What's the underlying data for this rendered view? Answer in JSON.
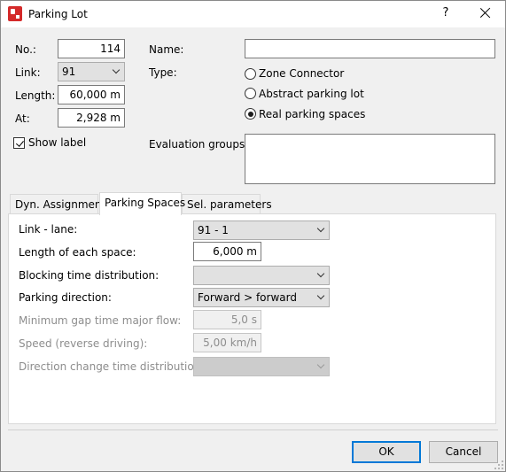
{
  "window": {
    "title": "Parking Lot",
    "help_label": "?",
    "close_icon": "close-icon",
    "app_icon": "parking-lot-app-icon",
    "accent": "#0078d7"
  },
  "general": {
    "no_label": "No.:",
    "no_value": "114",
    "link_label": "Link:",
    "link_value": "91",
    "length_label": "Length:",
    "length_value": "60,000 m",
    "at_label": "At:",
    "at_value": "2,928 m",
    "show_label_text": "Show label",
    "show_label_checked": true,
    "name_label": "Name:",
    "name_value": "",
    "type_label": "Type:",
    "type_options": [
      "Zone Connector",
      "Abstract parking lot",
      "Real parking spaces"
    ],
    "type_selected": "Real parking spaces",
    "eval_groups_label": "Evaluation groups:",
    "eval_groups_value": ""
  },
  "tabs": [
    "Dyn. Assignment",
    "Parking Spaces",
    "Sel. parameters"
  ],
  "active_tab": "Parking Spaces",
  "parking_spaces": {
    "link_lane_label": "Link - lane:",
    "link_lane_value": "91 - 1",
    "length_each_label": "Length of each space:",
    "length_each_value": "6,000 m",
    "blocking_time_label": "Blocking time distribution:",
    "blocking_time_value": "",
    "parking_direction_label": "Parking direction:",
    "parking_direction_value": "Forward > forward",
    "min_gap_label": "Minimum gap time major flow:",
    "min_gap_value": "5,0 s",
    "speed_label": "Speed (reverse driving):",
    "speed_value": "5,00 km/h",
    "direction_change_label": "Direction change time distribution:",
    "direction_change_value": ""
  },
  "buttons": {
    "ok": "OK",
    "cancel": "Cancel"
  }
}
